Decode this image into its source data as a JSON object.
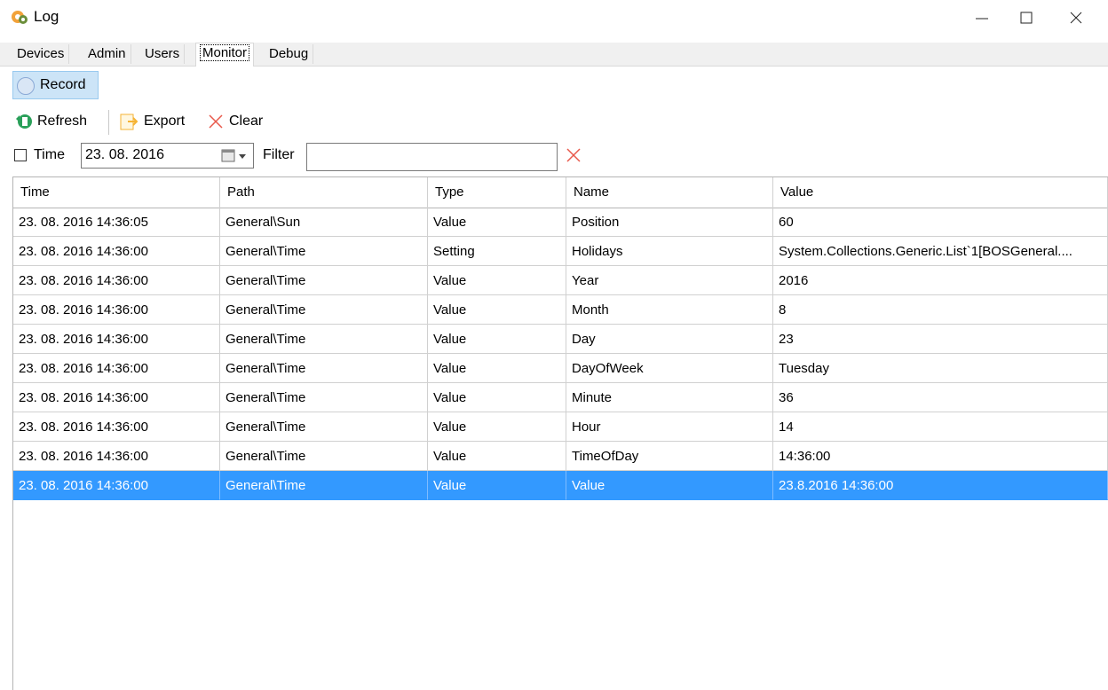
{
  "window": {
    "title": "Log",
    "minimize": "—",
    "maximize": "☐",
    "close": "✕"
  },
  "tabs": [
    {
      "label": "Devices"
    },
    {
      "label": "Admin"
    },
    {
      "label": "Users"
    },
    {
      "label": "Monitor",
      "active": true
    },
    {
      "label": "Debug"
    }
  ],
  "record": {
    "label": "Record"
  },
  "toolbar": {
    "refresh": "Refresh",
    "export": "Export",
    "clear": "Clear"
  },
  "filterbar": {
    "time_label": "Time",
    "time_checked": false,
    "date_value": "23. 08. 2016",
    "filter_label": "Filter",
    "filter_value": ""
  },
  "grid": {
    "columns": [
      "Time",
      "Path",
      "Type",
      "Name",
      "Value"
    ],
    "rows": [
      [
        "23. 08. 2016 14:36:05",
        "General\\Sun",
        "Value",
        "Position",
        "60"
      ],
      [
        "23. 08. 2016 14:36:00",
        "General\\Time",
        "Setting",
        "Holidays",
        "System.Collections.Generic.List`1[BOSGeneral...."
      ],
      [
        "23. 08. 2016 14:36:00",
        "General\\Time",
        "Value",
        "Year",
        "2016"
      ],
      [
        "23. 08. 2016 14:36:00",
        "General\\Time",
        "Value",
        "Month",
        "8"
      ],
      [
        "23. 08. 2016 14:36:00",
        "General\\Time",
        "Value",
        "Day",
        "23"
      ],
      [
        "23. 08. 2016 14:36:00",
        "General\\Time",
        "Value",
        "DayOfWeek",
        "Tuesday"
      ],
      [
        "23. 08. 2016 14:36:00",
        "General\\Time",
        "Value",
        "Minute",
        "36"
      ],
      [
        "23. 08. 2016 14:36:00",
        "General\\Time",
        "Value",
        "Hour",
        "14"
      ],
      [
        "23. 08. 2016 14:36:00",
        "General\\Time",
        "Value",
        "TimeOfDay",
        "14:36:00"
      ],
      [
        "23. 08. 2016 14:36:00",
        "General\\Time",
        "Value",
        "Value",
        "23.8.2016 14:36:00"
      ]
    ],
    "selected_row": 9
  },
  "colors": {
    "selection": "#3399ff",
    "record_bg": "#cce4f7",
    "clear_icon": "#e8584a",
    "export_icon": "#f5b335",
    "refresh_icon": "#2aa05a"
  },
  "icons": {
    "app": "gear-icon",
    "record": "record-circle-icon",
    "refresh": "refresh-icon",
    "export": "export-icon",
    "clear": "clear-x-icon",
    "calendar": "calendar-icon",
    "clear_filter": "clear-filter-icon"
  }
}
